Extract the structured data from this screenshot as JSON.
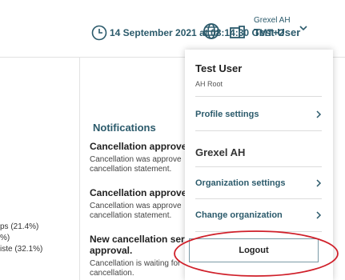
{
  "header": {
    "datetime": "14 September 2021 at 08:14:30 GMT+2",
    "user_org": "Grexel AH",
    "user_name": "Test User"
  },
  "background": {
    "legend": [
      "ps (21.4%)",
      "%)",
      "iste (32.1%)"
    ],
    "notifications": {
      "title": "Notifications",
      "items": [
        {
          "heading": "Cancellation approve",
          "body_lines": [
            "Cancellation was approve",
            "cancellation statement."
          ]
        },
        {
          "heading": "Cancellation approve",
          "body_lines": [
            "Cancellation was approve",
            "cancellation statement."
          ]
        },
        {
          "heading_lines": [
            "New cancellation ser",
            "approval."
          ],
          "body_lines": [
            "Cancellation is waiting for",
            "cancellation."
          ]
        }
      ]
    }
  },
  "menu": {
    "user_name": "Test User",
    "role": "AH Root",
    "profile_settings": "Profile settings",
    "org_name": "Grexel AH",
    "organization_settings": "Organization settings",
    "change_organization": "Change organization",
    "logout": "Logout"
  },
  "colors": {
    "accent": "#2b5a6b",
    "highlight": "#d0202a"
  },
  "icons": [
    "clock-icon",
    "globe-icon",
    "org-switch-icon",
    "chevron-down-icon",
    "chevron-right-icon"
  ]
}
